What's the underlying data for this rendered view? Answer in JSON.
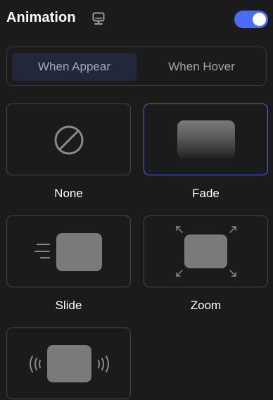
{
  "header": {
    "title": "Animation",
    "device_icon": "desktop-icon",
    "toggle_on": true,
    "accent_color": "#4a6cf7"
  },
  "tabs": {
    "active": "When Appear",
    "items": [
      {
        "label": "When Appear"
      },
      {
        "label": "When Hover"
      }
    ]
  },
  "options": [
    {
      "label": "None",
      "icon": "none-icon",
      "selected": false
    },
    {
      "label": "Fade",
      "icon": "fade-icon",
      "selected": true
    },
    {
      "label": "Slide",
      "icon": "slide-icon",
      "selected": false
    },
    {
      "label": "Zoom",
      "icon": "zoom-icon",
      "selected": false
    },
    {
      "label": "",
      "icon": "shake-icon",
      "selected": false
    }
  ]
}
